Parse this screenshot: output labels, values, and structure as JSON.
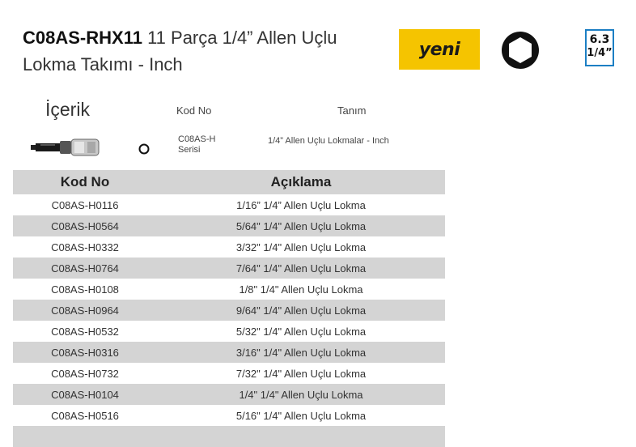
{
  "header": {
    "product_code": "C08AS-RHX11",
    "product_title": " 11 Parça 1/4” Allen Uçlu Lokma Takımı - Inch",
    "new_badge": "yeni",
    "drive_mm": "6.3",
    "drive_inch": "1/4”"
  },
  "contents": {
    "label": "İçerik",
    "col_code": "Kod No",
    "col_desc": "Tanım",
    "item_code": "C08AS-H Serisi",
    "item_desc": "1/4” Allen Uçlu Lokmalar - Inch"
  },
  "table": {
    "headers": {
      "code": "Kod No",
      "desc": "Açıklama"
    },
    "rows": [
      {
        "code": "C08AS-H0116",
        "desc": "1/16” 1/4” Allen Uçlu Lokma"
      },
      {
        "code": "C08AS-H0564",
        "desc": "5/64\" 1/4\" Allen Uçlu Lokma"
      },
      {
        "code": "C08AS-H0332",
        "desc": "3/32\" 1/4\" Allen Uçlu Lokma"
      },
      {
        "code": "C08AS-H0764",
        "desc": "7/64\" 1/4\" Allen Uçlu Lokma"
      },
      {
        "code": "C08AS-H0108",
        "desc": "1/8\" 1/4\" Allen Uçlu Lokma"
      },
      {
        "code": "C08AS-H0964",
        "desc": "9/64\" 1/4\" Allen Uçlu Lokma"
      },
      {
        "code": "C08AS-H0532",
        "desc": "5/32\" 1/4\" Allen Uçlu Lokma"
      },
      {
        "code": "C08AS-H0316",
        "desc": "3/16\" 1/4\" Allen Uçlu Lokma"
      },
      {
        "code": "C08AS-H0732",
        "desc": "7/32\" 1/4\" Allen Uçlu Lokma"
      },
      {
        "code": "C08AS-H0104",
        "desc": "1/4\" 1/4\" Allen Uçlu Lokma"
      },
      {
        "code": "C08AS-H0516",
        "desc": "5/16\" 1/4\" Allen Uçlu Lokma"
      }
    ]
  },
  "colors": {
    "badge": "#f5c400",
    "drive_border": "#1c7fc4",
    "row_alt": "#d4d4d4"
  },
  "icons": {
    "hex": "hexagon-icon",
    "tool": "allen-socket-icon",
    "ring": "ring-icon"
  }
}
